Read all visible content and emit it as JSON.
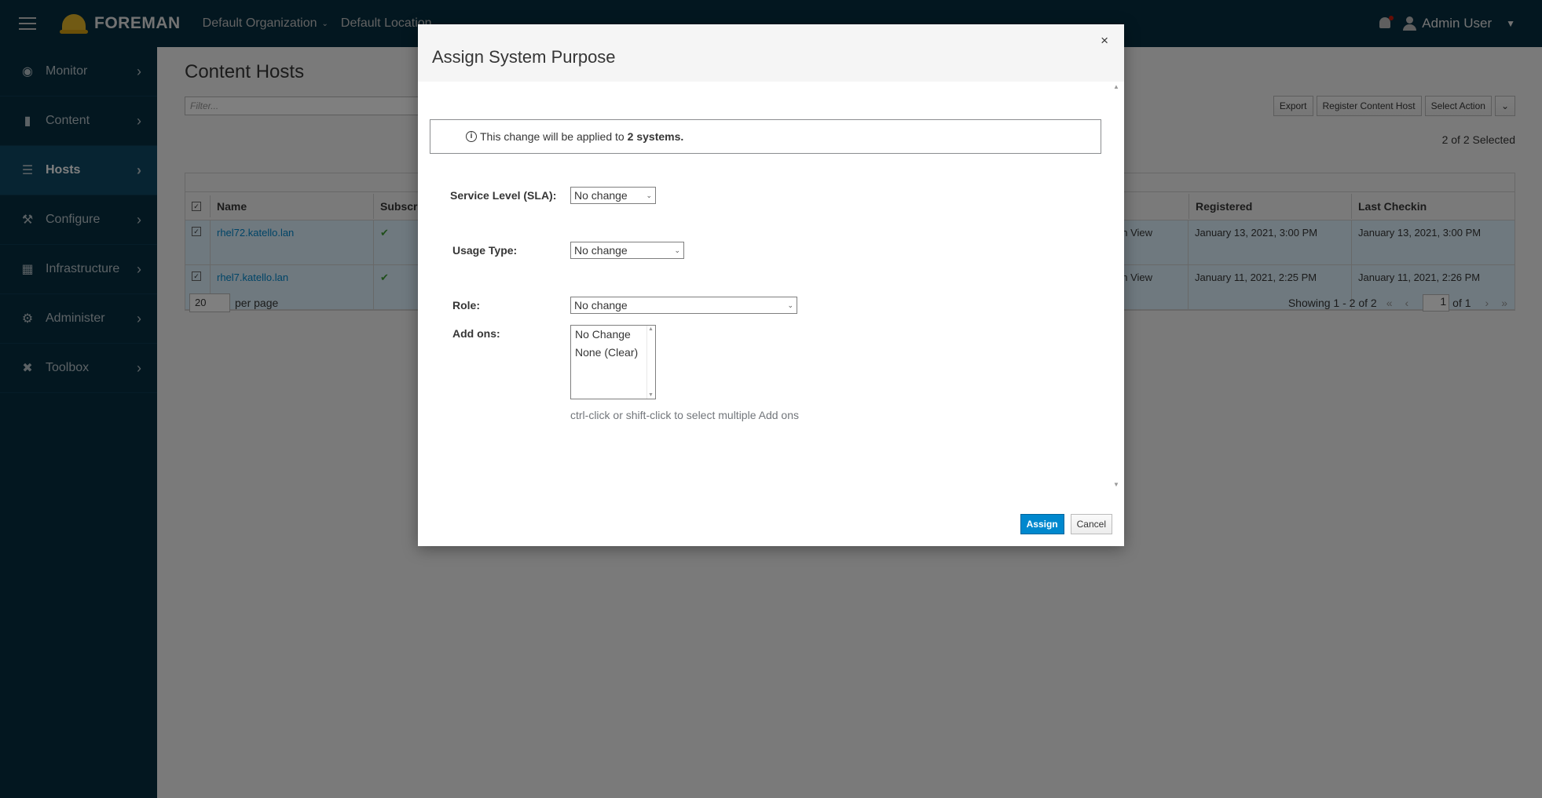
{
  "topbar": {
    "brand": "FOREMAN",
    "organization": "Default Organization",
    "location": "Default Location",
    "user": "Admin User"
  },
  "sidebar": {
    "items": [
      {
        "label": "Monitor",
        "icon": "dashboard-icon"
      },
      {
        "label": "Content",
        "icon": "book-icon"
      },
      {
        "label": "Hosts",
        "icon": "server-icon",
        "active": true
      },
      {
        "label": "Configure",
        "icon": "wrench-icon"
      },
      {
        "label": "Infrastructure",
        "icon": "network-icon"
      },
      {
        "label": "Administer",
        "icon": "gear-icon"
      },
      {
        "label": "Toolbox",
        "icon": "tools-icon"
      }
    ]
  },
  "main": {
    "title": "Content Hosts",
    "filter_placeholder": "Filter...",
    "buttons": {
      "export": "Export",
      "register": "Register Content Host",
      "select_action": "Select Action"
    },
    "selected_count": "2 of 2 Selected",
    "table": {
      "columns": [
        "Name",
        "Subscri",
        "Registered",
        "Last Checkin"
      ],
      "rows": [
        {
          "name": "rhel72.katello.lan",
          "cv": "on View",
          "registered": "January 13, 2021, 3:00 PM",
          "last_checkin": "January 13, 2021, 3:00 PM"
        },
        {
          "name": "rhel7.katello.lan",
          "cv": "on View",
          "registered": "January 11, 2021, 2:25 PM",
          "last_checkin": "January 11, 2021, 2:26 PM"
        }
      ]
    },
    "pager": {
      "per_page_value": "20",
      "per_page_label": "per page",
      "showing": "Showing 1 - 2 of 2",
      "page": "1",
      "of_pages": "of 1"
    }
  },
  "modal": {
    "title": "Assign System Purpose",
    "close": "×",
    "alert_prefix": "This change will be applied to ",
    "alert_bold": "2 systems.",
    "fields": {
      "sla_label": "Service Level (SLA):",
      "sla_value": "No change",
      "usage_label": "Usage Type:",
      "usage_value": "No change",
      "role_label": "Role:",
      "role_value": "No change",
      "addons_label": "Add ons:",
      "addons_options": [
        "No Change",
        "None (Clear)"
      ]
    },
    "hint": "ctrl-click or shift-click to select multiple Add ons",
    "assign_button": "Assign",
    "cancel_button": "Cancel"
  }
}
